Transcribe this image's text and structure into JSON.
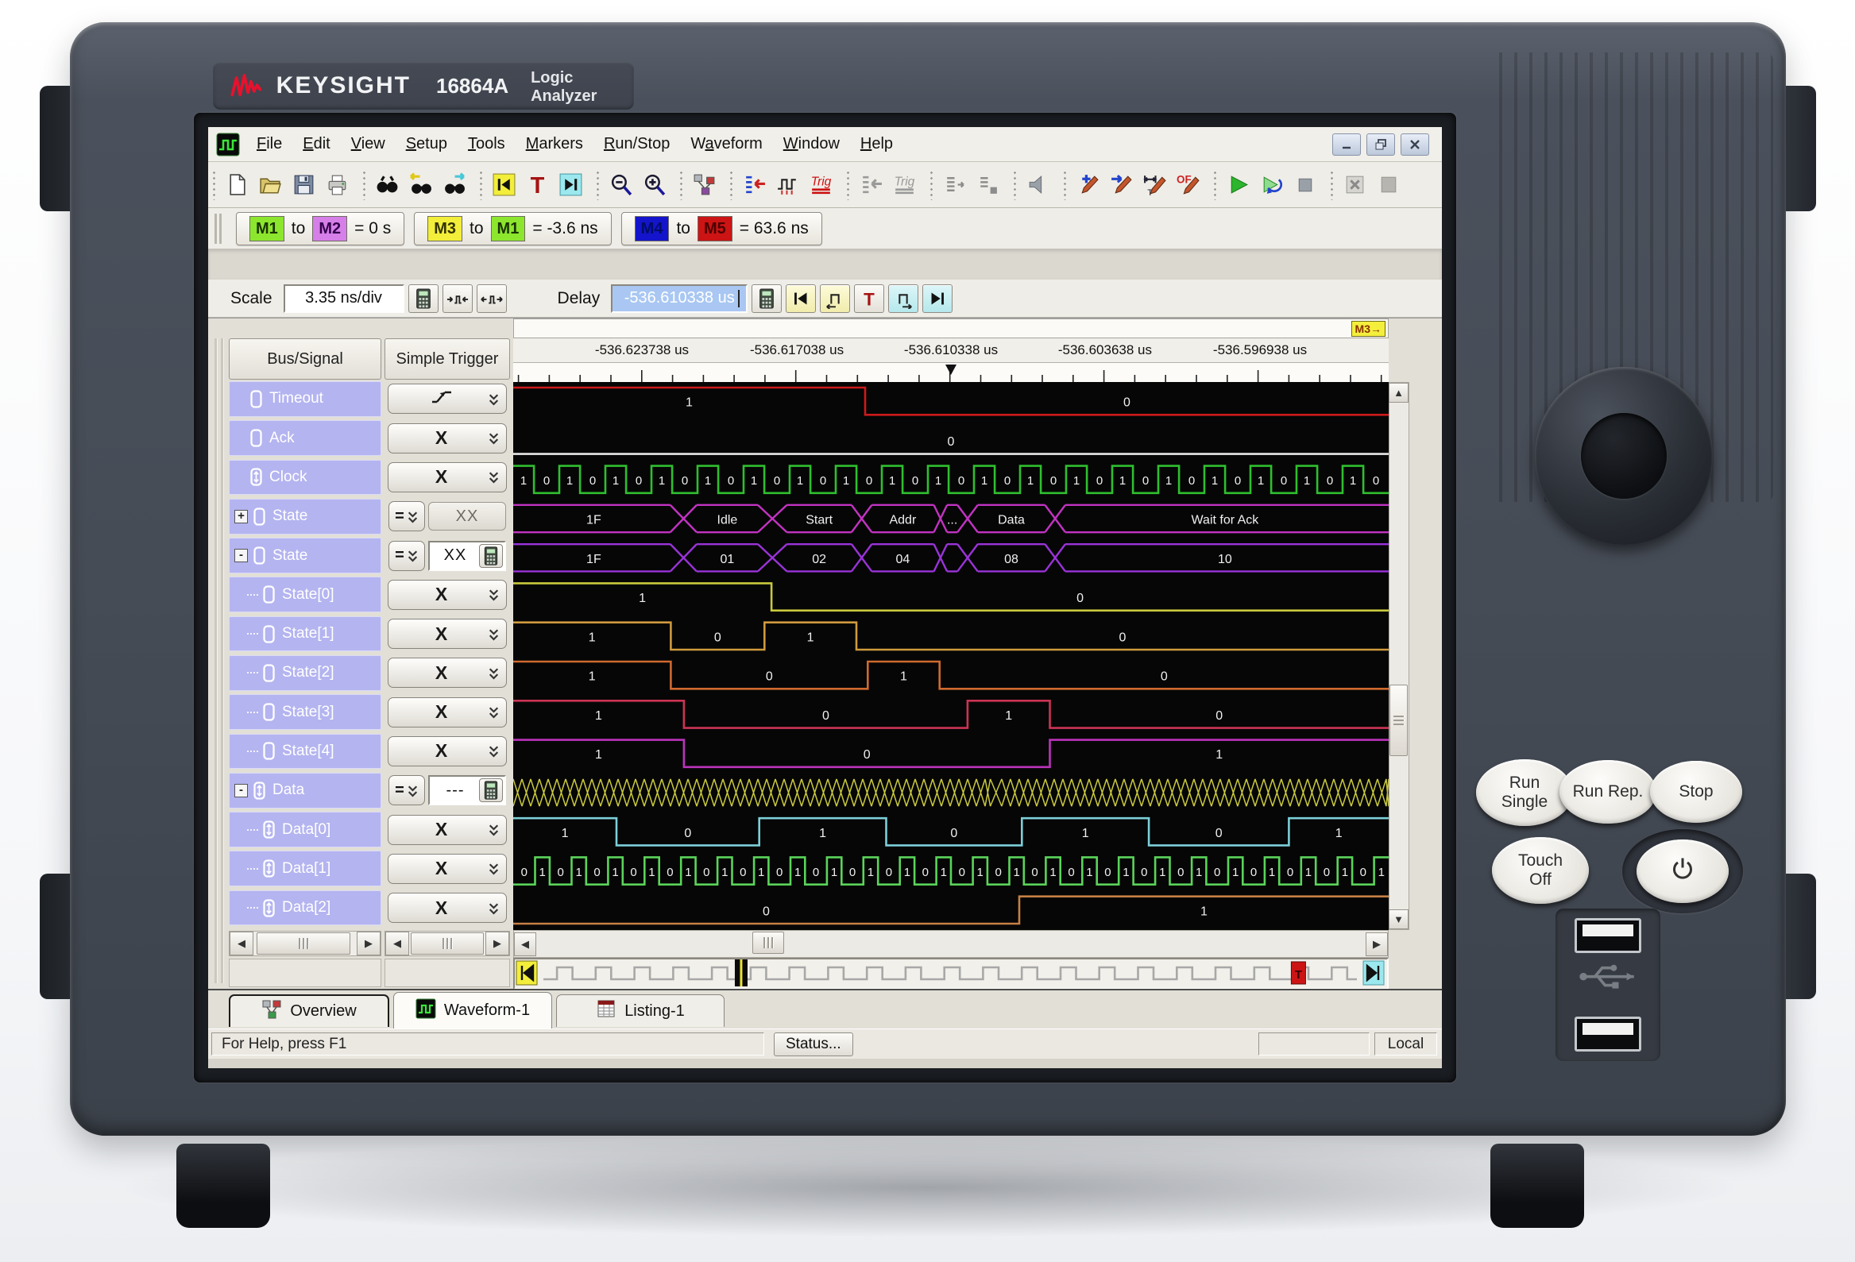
{
  "device": {
    "brand": "KEYSIGHT",
    "model": "16864A",
    "product": "Logic Analyzer",
    "front_buttons": [
      {
        "id": "run-single",
        "label": "Run\nSingle"
      },
      {
        "id": "run-rep",
        "label": "Run Rep."
      },
      {
        "id": "stop",
        "label": "Stop"
      },
      {
        "id": "touch-off",
        "label": "Touch\nOff"
      },
      {
        "id": "power",
        "label": ""
      }
    ]
  },
  "window": {
    "app_icon": "waveform-app-icon",
    "menus": [
      {
        "label": "File",
        "u": 0
      },
      {
        "label": "Edit",
        "u": 0
      },
      {
        "label": "View",
        "u": 0
      },
      {
        "label": "Setup",
        "u": 0
      },
      {
        "label": "Tools",
        "u": 0
      },
      {
        "label": "Markers",
        "u": 0
      },
      {
        "label": "Run/Stop",
        "u": 0
      },
      {
        "label": "Waveform",
        "u": 1
      },
      {
        "label": "Window",
        "u": 0
      },
      {
        "label": "Help",
        "u": 0
      }
    ],
    "window_buttons": [
      "minimize",
      "restore",
      "close"
    ]
  },
  "toolbar": {
    "groups": [
      [
        "new-doc",
        "open-folder",
        "save",
        "print"
      ],
      [
        "find",
        "find-prev",
        "find-next"
      ],
      [
        "goto-begin",
        "goto-trigger",
        "goto-end"
      ],
      [
        "zoom-out",
        "zoom-in"
      ],
      [
        "marker-chart"
      ],
      [
        "listing-trigger",
        "edge-trigger",
        "trig-red"
      ],
      [
        "listing-trigger-gray",
        "trig-gray"
      ],
      [
        "list-a",
        "list-b"
      ],
      [
        "speaker"
      ],
      [
        "marker-add",
        "marker-goto",
        "marker-width",
        "marker-of"
      ],
      [
        "run",
        "run-repetitive",
        "stop-sq"
      ],
      [
        "cancel",
        "blank"
      ]
    ],
    "trig_text": "Trig"
  },
  "marker_bar": [
    {
      "from": "M1",
      "from_color": "#8ce62e",
      "from_text": "#1a3300",
      "to": "M2",
      "to_color": "#d67fe8",
      "to_text": "#33004d",
      "text": "= 0 s"
    },
    {
      "from": "M3",
      "from_color": "#f2ee3a",
      "from_text": "#333300",
      "to": "M1",
      "to_color": "#8ce62e",
      "to_text": "#1a3300",
      "text": "= -3.6 ns"
    },
    {
      "from": "M4",
      "from_color": "#1414cc",
      "from_text": "#000d66",
      "to": "M5",
      "to_color": "#cc1414",
      "to_text": "#4d0000",
      "text": "= 63.6 ns"
    }
  ],
  "controls": {
    "scale_label": "Scale",
    "scale_value": "3.35 ns/div",
    "delay_label": "Delay",
    "delay_value": "-536.610338 us"
  },
  "panel": {
    "bus_header": "Bus/Signal",
    "trigger_header": "Simple Trigger",
    "rows": [
      {
        "name": "Timeout",
        "icon": "signal",
        "level": 0,
        "trigger": {
          "kind": "edge"
        }
      },
      {
        "name": "Ack",
        "icon": "signal",
        "level": 0,
        "trigger": {
          "kind": "any",
          "value": "X"
        }
      },
      {
        "name": "Clock",
        "icon": "clock",
        "level": 0,
        "trigger": {
          "kind": "any",
          "value": "X"
        }
      },
      {
        "name": "State",
        "icon": "signal",
        "level": 0,
        "expand": "+",
        "trigger": {
          "kind": "compare",
          "op": "=",
          "value": "XX",
          "style": "flat"
        }
      },
      {
        "name": "State",
        "icon": "signal",
        "level": 0,
        "expand": "-",
        "trigger": {
          "kind": "compare",
          "op": "=",
          "value": "XX",
          "style": "edit"
        }
      },
      {
        "name": "State[0]",
        "icon": "signal",
        "level": 1,
        "trigger": {
          "kind": "any",
          "value": "X"
        }
      },
      {
        "name": "State[1]",
        "icon": "signal",
        "level": 1,
        "trigger": {
          "kind": "any",
          "value": "X"
        }
      },
      {
        "name": "State[2]",
        "icon": "signal",
        "level": 1,
        "trigger": {
          "kind": "any",
          "value": "X"
        }
      },
      {
        "name": "State[3]",
        "icon": "signal",
        "level": 1,
        "trigger": {
          "kind": "any",
          "value": "X"
        }
      },
      {
        "name": "State[4]",
        "icon": "signal",
        "level": 1,
        "trigger": {
          "kind": "any",
          "value": "X"
        }
      },
      {
        "name": "Data",
        "icon": "clock",
        "level": 0,
        "expand": "-",
        "trigger": {
          "kind": "compare",
          "op": "=",
          "value": "---",
          "style": "edit"
        }
      },
      {
        "name": "Data[0]",
        "icon": "clock",
        "level": 1,
        "trigger": {
          "kind": "any",
          "value": "X"
        }
      },
      {
        "name": "Data[1]",
        "icon": "clock",
        "level": 1,
        "trigger": {
          "kind": "any",
          "value": "X"
        }
      },
      {
        "name": "Data[2]",
        "icon": "clock",
        "level": 1,
        "trigger": {
          "kind": "any",
          "value": "X"
        }
      }
    ]
  },
  "chart_data": {
    "type": "logic-waveform",
    "time_axis": {
      "labels": [
        "-536.623738 us",
        "-536.617038 us",
        "-536.610338 us",
        "-536.603638 us",
        "-536.596938 us"
      ],
      "label_fracs": [
        0.147,
        0.324,
        0.5,
        0.676,
        0.853
      ],
      "trigger_frac": 0.5,
      "marker_flag": "M3→",
      "scale": "3.35 ns/div",
      "delay": "-536.610338 us"
    },
    "overview_bar": {
      "cursor_frac": 0.26,
      "trigger_frac": 0.9
    },
    "signals": [
      {
        "name": "Timeout",
        "kind": "digital",
        "color": "#cc1a1a",
        "segments": [
          {
            "value": "1",
            "from": 0,
            "to": 0.402
          },
          {
            "value": "0",
            "from": 0.402,
            "to": 1
          }
        ]
      },
      {
        "name": "Ack",
        "kind": "digital",
        "color": "#e8e8e8",
        "segments": [
          {
            "value": "0",
            "from": 0,
            "to": 1
          }
        ]
      },
      {
        "name": "Clock",
        "kind": "clock",
        "color": "#2fbf2f",
        "periods": 19,
        "duty": 0.45,
        "first": "1",
        "half_labels": [
          "1",
          "0"
        ]
      },
      {
        "name": "State",
        "kind": "bus",
        "color": "#c233c2",
        "segments": [
          {
            "value": "1F",
            "from": 0,
            "to": 0.184
          },
          {
            "value": "Idle",
            "from": 0.205,
            "to": 0.284
          },
          {
            "value": "Start",
            "from": 0.308,
            "to": 0.391
          },
          {
            "value": "Addr",
            "from": 0.405,
            "to": 0.485
          },
          {
            "value": "...",
            "from": 0.491,
            "to": 0.512
          },
          {
            "value": "Data",
            "from": 0.526,
            "to": 0.612
          },
          {
            "value": "Wait for Ack",
            "from": 0.626,
            "to": 1
          }
        ]
      },
      {
        "name": "State",
        "kind": "bus",
        "color": "#9a33d9",
        "segments": [
          {
            "value": "1F",
            "from": 0,
            "to": 0.184
          },
          {
            "value": "01",
            "from": 0.205,
            "to": 0.284
          },
          {
            "value": "02",
            "from": 0.308,
            "to": 0.391
          },
          {
            "value": "04",
            "from": 0.405,
            "to": 0.485
          },
          {
            "value": "",
            "from": 0.491,
            "to": 0.512
          },
          {
            "value": "08",
            "from": 0.526,
            "to": 0.612
          },
          {
            "value": "10",
            "from": 0.626,
            "to": 1
          }
        ]
      },
      {
        "name": "State[0]",
        "kind": "digital",
        "color": "#c9c93e",
        "segments": [
          {
            "value": "1",
            "from": 0,
            "to": 0.295
          },
          {
            "value": "0",
            "from": 0.295,
            "to": 1
          }
        ]
      },
      {
        "name": "State[1]",
        "kind": "digital",
        "color": "#d09a3e",
        "segments": [
          {
            "value": "1",
            "from": 0,
            "to": 0.18
          },
          {
            "value": "0",
            "from": 0.18,
            "to": 0.287
          },
          {
            "value": "1",
            "from": 0.287,
            "to": 0.392
          },
          {
            "value": "0",
            "from": 0.392,
            "to": 1
          }
        ]
      },
      {
        "name": "State[2]",
        "kind": "digital",
        "color": "#cf6a2f",
        "segments": [
          {
            "value": "1",
            "from": 0,
            "to": 0.18
          },
          {
            "value": "0",
            "from": 0.18,
            "to": 0.405
          },
          {
            "value": "1",
            "from": 0.405,
            "to": 0.487
          },
          {
            "value": "0",
            "from": 0.487,
            "to": 1
          }
        ]
      },
      {
        "name": "State[3]",
        "kind": "digital",
        "color": "#cc3355",
        "segments": [
          {
            "value": "1",
            "from": 0,
            "to": 0.195
          },
          {
            "value": "0",
            "from": 0.195,
            "to": 0.519
          },
          {
            "value": "1",
            "from": 0.519,
            "to": 0.613
          },
          {
            "value": "0",
            "from": 0.613,
            "to": 1
          }
        ]
      },
      {
        "name": "State[4]",
        "kind": "digital",
        "color": "#bb33bb",
        "segments": [
          {
            "value": "1",
            "from": 0,
            "to": 0.195
          },
          {
            "value": "0",
            "from": 0.195,
            "to": 0.613
          },
          {
            "value": "1",
            "from": 0.613,
            "to": 1
          }
        ]
      },
      {
        "name": "Data",
        "kind": "xpattern",
        "color": "#c9c93e",
        "bands": [
          [
            0,
            0.545
          ],
          [
            0.558,
            1
          ]
        ]
      },
      {
        "name": "Data[0]",
        "kind": "digital",
        "color": "#7ccfd8",
        "segments": [
          {
            "value": "1",
            "from": 0,
            "to": 0.118
          },
          {
            "value": "0",
            "from": 0.118,
            "to": 0.281
          },
          {
            "value": "1",
            "from": 0.281,
            "to": 0.426
          },
          {
            "value": "0",
            "from": 0.426,
            "to": 0.581
          },
          {
            "value": "1",
            "from": 0.581,
            "to": 0.726
          },
          {
            "value": "0",
            "from": 0.726,
            "to": 0.886
          },
          {
            "value": "1",
            "from": 0.886,
            "to": 1
          }
        ]
      },
      {
        "name": "Data[1]",
        "kind": "clock",
        "color": "#5ad45a",
        "periods": 24,
        "duty": 0.4,
        "first": "0",
        "half_labels": [
          "0",
          "1"
        ]
      },
      {
        "name": "Data[2]",
        "kind": "digital",
        "color": "#c58045",
        "segments": [
          {
            "value": "0",
            "from": 0,
            "to": 0.578
          },
          {
            "value": "1",
            "from": 0.578,
            "to": 1
          }
        ]
      }
    ]
  },
  "tabs": [
    {
      "label": "Overview",
      "icon": "overview-icon",
      "active": false,
      "focused": true
    },
    {
      "label": "Waveform-1",
      "icon": "waveform-icon",
      "active": true,
      "focused": false
    },
    {
      "label": "Listing-1",
      "icon": "listing-icon",
      "active": false,
      "focused": false
    }
  ],
  "status": {
    "help_text": "For Help, press F1",
    "status_button": "Status...",
    "mode": "Local"
  }
}
